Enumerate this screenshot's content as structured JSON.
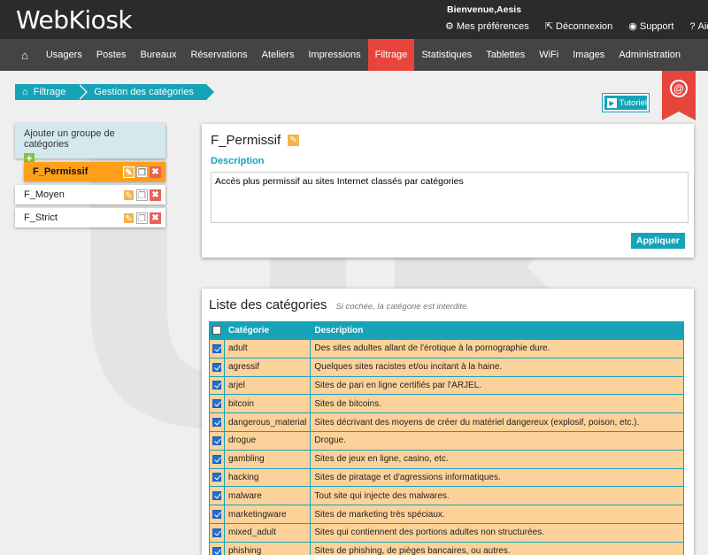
{
  "app": {
    "logo": "WebKiosk"
  },
  "user": {
    "welcome": "Bienvenue,Aesis"
  },
  "toplinks": [
    {
      "icon": "⚙",
      "label": "Mes préférences"
    },
    {
      "icon": "⇱",
      "label": "Déconnexion"
    },
    {
      "icon": "◉",
      "label": "Support"
    },
    {
      "icon": "?",
      "label": "Aide"
    }
  ],
  "nav": [
    "Usagers",
    "Postes",
    "Bureaux",
    "Réservations",
    "Ateliers",
    "Impressions",
    "Filtrage",
    "Statistiques",
    "Tablettes",
    "WiFi",
    "Images",
    "Administration"
  ],
  "nav_active": "Filtrage",
  "breadcrumb": {
    "first": "Filtrage",
    "second": "Gestion des catégories"
  },
  "tutorial_label": "Tutoriel",
  "groups": {
    "add_label": "Ajouter un groupe de catégories",
    "items": [
      {
        "name": "F_Permissif",
        "active": true
      },
      {
        "name": "F_Moyen",
        "active": false
      },
      {
        "name": "F_Strict",
        "active": false
      }
    ]
  },
  "detail": {
    "title": "F_Permissif",
    "desc_label": "Description",
    "desc_value": "Accès plus permissif au sites Internet classés par catégories",
    "apply_label": "Appliquer"
  },
  "list": {
    "title": "Liste des catégories",
    "note": "Si cochée, la catégorie est interdite.",
    "col_category": "Catégorie",
    "col_description": "Description",
    "rows": [
      {
        "checked": true,
        "category": "adult",
        "description": "Des sites adultes allant de l'érotique à la pornographie dure."
      },
      {
        "checked": true,
        "category": "agressif",
        "description": "Quelques sites racistes et/ou incitant à la haine."
      },
      {
        "checked": true,
        "category": "arjel",
        "description": "Sites de pari en ligne certifiés par l'ARJEL."
      },
      {
        "checked": true,
        "category": "bitcoin",
        "description": "Sites de bitcoins."
      },
      {
        "checked": true,
        "category": "dangerous_material",
        "description": "Sites décrivant des moyens de créer du matériel dangereux (explosif, poison, etc.)."
      },
      {
        "checked": true,
        "category": "drogue",
        "description": "Drogue."
      },
      {
        "checked": true,
        "category": "gambling",
        "description": "Sites de jeux en ligne, casino, etc."
      },
      {
        "checked": true,
        "category": "hacking",
        "description": "Sites de piratage et d'agressions informatiques."
      },
      {
        "checked": true,
        "category": "malware",
        "description": "Tout site qui injecte des malwares."
      },
      {
        "checked": true,
        "category": "marketingware",
        "description": "Sites de marketing très spéciaux."
      },
      {
        "checked": true,
        "category": "mixed_adult",
        "description": "Sites qui contiennent des portions adultes non structurées."
      },
      {
        "checked": true,
        "category": "phishing",
        "description": "Sites de phishing, de pièges bancaires, ou autres."
      }
    ]
  },
  "colors": {
    "accent": "#16a3b8",
    "active_nav": "#e7453b",
    "active_group": "#ff9f1a",
    "row_bg": "#fdd29a"
  }
}
